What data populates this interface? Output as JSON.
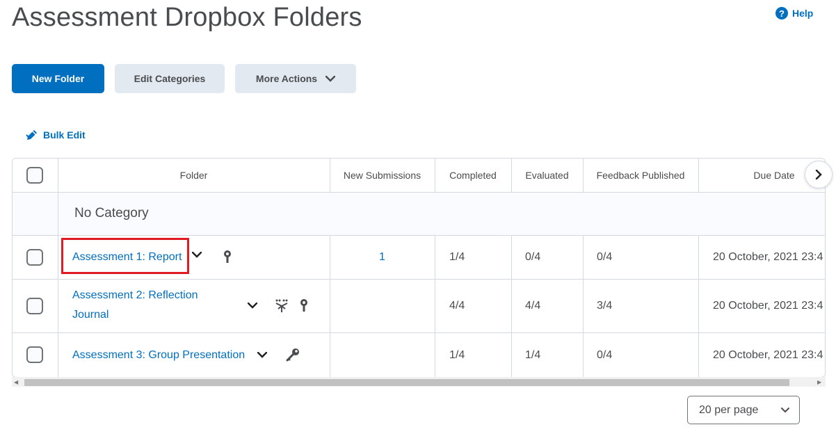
{
  "page": {
    "title": "Assessment Dropbox Folders",
    "help_label": "Help"
  },
  "toolbar": {
    "new_folder": "New Folder",
    "edit_categories": "Edit Categories",
    "more_actions": "More Actions",
    "bulk_edit": "Bulk Edit"
  },
  "table": {
    "columns": [
      "Folder",
      "New Submissions",
      "Completed",
      "Evaluated",
      "Feedback Published",
      "Due Date"
    ],
    "category": "No Category",
    "rows": [
      {
        "folder": "Assessment 1: Report",
        "new_submissions": "1",
        "completed": "1/4",
        "evaluated": "0/4",
        "feedback_published": "0/4",
        "due_date": "20 October, 2021 23:4",
        "icons": [
          "special-access-icon"
        ]
      },
      {
        "folder_line1": "Assessment 2: Reflection",
        "folder_line2": "Journal",
        "new_submissions": "",
        "completed": "4/4",
        "evaluated": "4/4",
        "feedback_published": "3/4",
        "due_date": "20 October, 2021 23:4",
        "icons": [
          "release-conditions-icon",
          "special-access-icon"
        ]
      },
      {
        "folder": "Assessment 3: Group Presentation",
        "new_submissions": "",
        "completed": "1/4",
        "evaluated": "1/4",
        "feedback_published": "0/4",
        "due_date": "20 October, 2021 23:4",
        "icons": [
          "restrictions-key-icon"
        ]
      }
    ]
  },
  "pagination": {
    "per_page": "20 per page"
  },
  "colors": {
    "accent": "#006fbf",
    "highlight": "#e01b24",
    "secondary_button": "#e3e9f1"
  }
}
